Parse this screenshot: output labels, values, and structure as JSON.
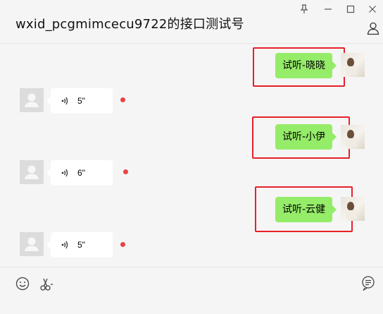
{
  "window": {
    "title": "wxid_pcgmimcecu9722的接口测试号"
  },
  "colors": {
    "background": "#f5f5f5",
    "outgoing_bubble": "#95ec69",
    "incoming_bubble": "#ffffff",
    "unread_dot": "#e94343",
    "highlight": "#e8202a"
  },
  "icons": {
    "pin": "pin-icon",
    "minimize": "minimize-icon",
    "maximize": "maximize-icon",
    "close": "close-icon",
    "profile": "person-icon",
    "voice": "voice-wave-icon",
    "emoji": "smiley-icon",
    "scissors": "scissors-icon",
    "history": "chat-history-icon"
  },
  "messages": [
    {
      "type": "text",
      "direction": "outgoing",
      "text": "试听-晓晓",
      "highlighted": true
    },
    {
      "type": "voice",
      "direction": "incoming",
      "duration": "5\"",
      "unread": true
    },
    {
      "type": "text",
      "direction": "outgoing",
      "text": "试听-小伊",
      "highlighted": true
    },
    {
      "type": "voice",
      "direction": "incoming",
      "duration": "6\"",
      "unread": true
    },
    {
      "type": "text",
      "direction": "outgoing",
      "text": "试听-云健",
      "highlighted": true
    },
    {
      "type": "voice",
      "direction": "incoming",
      "duration": "5\"",
      "unread": true
    }
  ]
}
